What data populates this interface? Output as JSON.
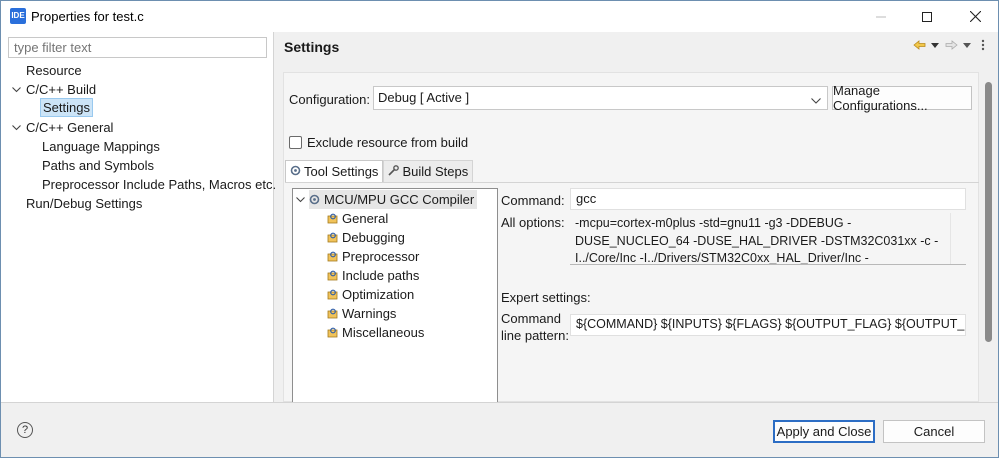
{
  "window": {
    "title": "Properties for test.c",
    "app_icon": "IDE"
  },
  "left": {
    "filter_placeholder": "type filter text",
    "tree": [
      {
        "label": "Resource"
      },
      {
        "label": "C/C++ Build"
      },
      {
        "label": "Settings"
      },
      {
        "label": "C/C++ General"
      },
      {
        "label": "Language Mappings"
      },
      {
        "label": "Paths and Symbols"
      },
      {
        "label": "Preprocessor Include Paths, Macros etc."
      },
      {
        "label": "Run/Debug Settings"
      }
    ]
  },
  "right": {
    "title": "Settings",
    "configuration_label": "Configuration:",
    "configuration_value": "Debug  [ Active ]",
    "manage_button": "Manage Configurations...",
    "exclude_label": "Exclude resource from build",
    "tabs": [
      {
        "label": "Tool Settings",
        "icon": "tool-settings-icon"
      },
      {
        "label": "Build Steps",
        "icon": "build-steps-icon"
      }
    ],
    "tool_tree": {
      "root": "MCU/MPU GCC Compiler",
      "children": [
        "General",
        "Debugging",
        "Preprocessor",
        "Include paths",
        "Optimization",
        "Warnings",
        "Miscellaneous"
      ]
    },
    "command_label": "Command:",
    "command_value": "gcc",
    "all_options_label": "All options:",
    "all_options_lines": [
      "-mcpu=cortex-m0plus -std=gnu11 -g3 -DDEBUG -",
      "DUSE_NUCLEO_64 -DUSE_HAL_DRIVER -DSTM32C031xx -c -",
      "I../Core/Inc -I../Drivers/STM32C0xx_HAL_Driver/Inc -"
    ],
    "expert_label": "Expert settings:",
    "cmd_pattern_label_1": "Command",
    "cmd_pattern_label_2": "line pattern:",
    "cmd_pattern_value": "${COMMAND} ${INPUTS} ${FLAGS} ${OUTPUT_FLAG} ${OUTPUT_PREFIX}$"
  },
  "buttons": {
    "apply_close": "Apply and Close",
    "cancel": "Cancel"
  },
  "colors": {
    "selection": "#cce4f7",
    "accent": "#2c6dc4"
  }
}
